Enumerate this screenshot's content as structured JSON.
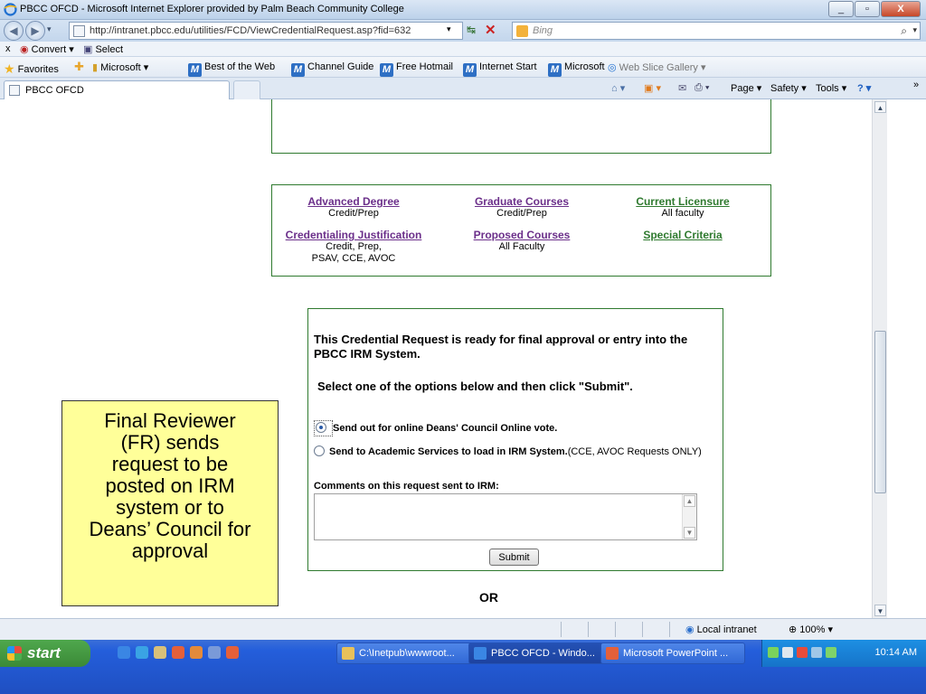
{
  "window": {
    "title": "PBCC OFCD - Microsoft Internet Explorer provided by Palm Beach Community College",
    "minimize": "_",
    "maximize": "▫",
    "close": "X"
  },
  "address": {
    "url": "http://intranet.pbcc.edu/utilities/FCD/ViewCredentialRequest.asp?fid=632",
    "search_placeholder": "Bing"
  },
  "command_bar": {
    "convert": "Convert ▾",
    "select": "Select",
    "close_x": "x"
  },
  "favorites": {
    "label": "Favorites",
    "items": [
      "Microsoft ▾",
      "Best of the Web",
      "Channel Guide",
      "Free Hotmail",
      "Internet Start",
      "Microsoft",
      "Web Slice Gallery ▾"
    ]
  },
  "tab": {
    "label": "PBCC OFCD"
  },
  "tab_tools": {
    "page": "Page ▾",
    "safety": "Safety ▾",
    "tools": "Tools ▾"
  },
  "links": [
    {
      "label": "Advanced Degree",
      "sub": "Credit/Prep",
      "color": "#6b2f8a"
    },
    {
      "label": "Graduate Courses",
      "sub": "Credit/Prep",
      "color": "#6b2f8a"
    },
    {
      "label": "Current Licensure",
      "sub": "All faculty",
      "color": "#2f7a2f"
    },
    {
      "label": "Credentialing Justification",
      "sub": "Credit, Prep,",
      "sub2": "PSAV, CCE, AVOC",
      "color": "#6b2f8a"
    },
    {
      "label": "Proposed Courses",
      "sub": "All Faculty",
      "color": "#6b2f8a"
    },
    {
      "label": "Special Criteria",
      "sub": "",
      "color": "#2f7a2f"
    }
  ],
  "form": {
    "message": "This Credential Request is ready for final approval or entry into the PBCC IRM System.",
    "instruction": "Select one of the options below and then click \"Submit\".",
    "option1": "Send out for online Deans' Council Online vote.",
    "option2_bold": "Send to Academic Services to load in IRM System.",
    "option2_rest": "(CCE, AVOC Requests ONLY)",
    "comments_label": "Comments on this request sent to IRM:",
    "comments_value": "",
    "submit": "Submit",
    "selected_option": 1
  },
  "or_text": "OR",
  "callout": {
    "lines": [
      "Final Reviewer",
      "(FR) sends",
      "request to be",
      "posted on IRM",
      "system or to",
      "Deans’ Council for",
      "approval"
    ]
  },
  "status": {
    "zone": "Local intranet",
    "zoom": "100%"
  },
  "taskbar": {
    "start": "start",
    "tasks": [
      "C:\\Inetpub\\wwwroot...",
      "PBCC OFCD - Windo...",
      "Microsoft PowerPoint ..."
    ],
    "clock": "10:14 AM"
  }
}
